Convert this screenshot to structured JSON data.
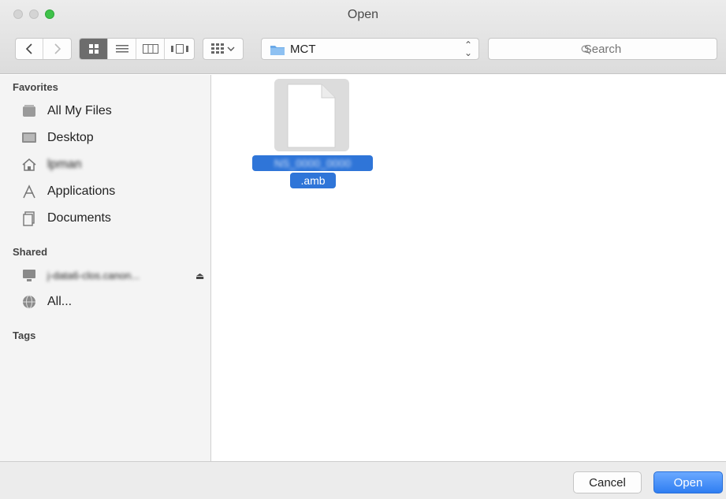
{
  "window": {
    "title": "Open"
  },
  "toolbar": {
    "path_folder": "MCT",
    "search_placeholder": "Search"
  },
  "sidebar": {
    "favorites_header": "Favorites",
    "favorites": [
      {
        "label": "All My Files",
        "icon": "all-my-files-icon"
      },
      {
        "label": "Desktop",
        "icon": "desktop-icon"
      },
      {
        "label": "lpman",
        "icon": "home-icon"
      },
      {
        "label": "Applications",
        "icon": "applications-icon"
      },
      {
        "label": "Documents",
        "icon": "documents-icon"
      }
    ],
    "shared_header": "Shared",
    "shared": [
      {
        "label": "j-data6-clos.canon...",
        "icon": "computer-icon"
      },
      {
        "label": "All...",
        "icon": "network-globe-icon"
      }
    ],
    "tags_header": "Tags"
  },
  "content": {
    "file": {
      "name_line1": "NS_0000_0000",
      "name_line2": ".amb"
    }
  },
  "buttons": {
    "cancel": "Cancel",
    "open": "Open"
  },
  "colors": {
    "accent": "#2f75d8",
    "zoom_green": "#3fc24a"
  }
}
